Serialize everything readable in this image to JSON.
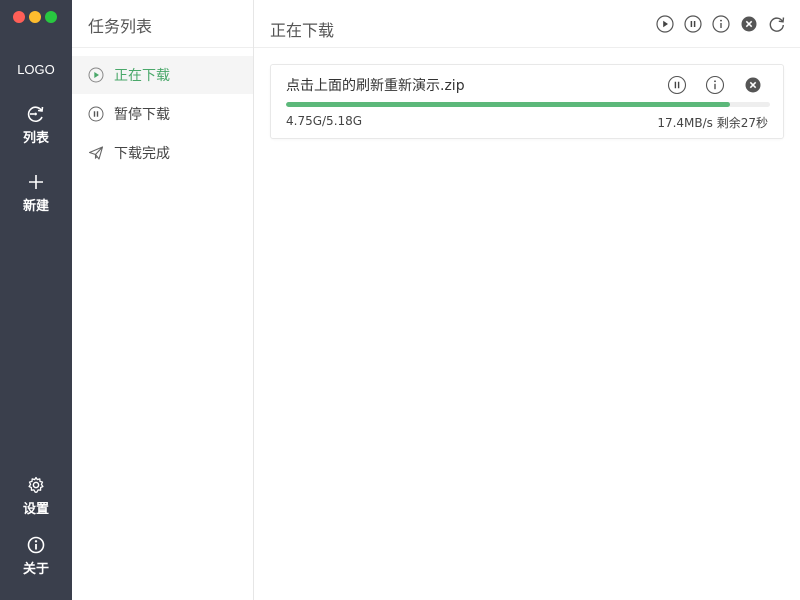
{
  "window": {
    "traffic_colors": [
      "#ff5f57",
      "#febc2e",
      "#28c840"
    ]
  },
  "rail": {
    "logo": "LOGO",
    "items": [
      {
        "label": "列表",
        "icon": "list-refresh-icon"
      },
      {
        "label": "新建",
        "icon": "plus-icon"
      },
      {
        "label": "设置",
        "icon": "gear-icon"
      },
      {
        "label": "关于",
        "icon": "info-icon"
      }
    ]
  },
  "tasklist": {
    "title": "任务列表",
    "items": [
      {
        "label": "正在下载",
        "icon": "play-circle-icon",
        "active": true
      },
      {
        "label": "暂停下载",
        "icon": "pause-circle-icon",
        "active": false
      },
      {
        "label": "下载完成",
        "icon": "paper-plane-icon",
        "active": false
      }
    ]
  },
  "main": {
    "title": "正在下载",
    "tools": [
      "play-icon",
      "pause-icon",
      "info-icon",
      "close-icon",
      "refresh-icon"
    ]
  },
  "download": {
    "name": "点击上面的刷新重新演示.zip",
    "size_text": "4.75G/5.18G",
    "speed_text": "17.4MB/s 剩余27秒",
    "progress": 0.917,
    "accent": "#5cb87a"
  }
}
